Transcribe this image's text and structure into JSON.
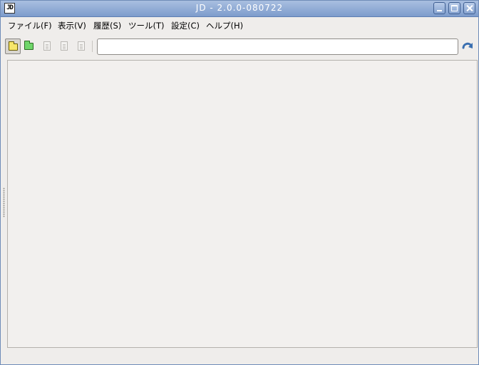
{
  "window": {
    "title": "JD - 2.0.0-080722",
    "app_icon_text": "JD"
  },
  "menubar": {
    "items": [
      {
        "label": "ファイル(F)"
      },
      {
        "label": "表示(V)"
      },
      {
        "label": "履歴(S)"
      },
      {
        "label": "ツール(T)"
      },
      {
        "label": "設定(C)"
      },
      {
        "label": "ヘルプ(H)"
      }
    ]
  },
  "toolbar": {
    "url_value": "",
    "icons": [
      "folder-open-icon",
      "folder-new-icon",
      "document-icon",
      "document-icon",
      "document-image-icon",
      "reload-icon"
    ],
    "colors": {
      "folder_yellow": "#f7e66b",
      "folder_green": "#6fd66a",
      "reload_blue": "#3a6fb0"
    }
  }
}
